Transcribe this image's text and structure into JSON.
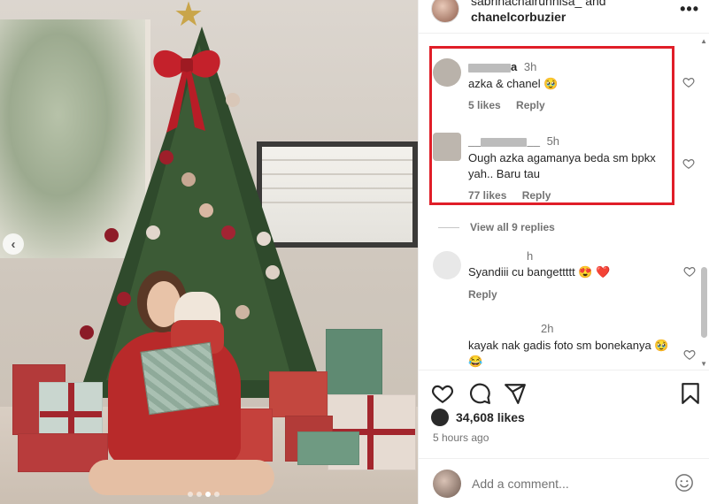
{
  "header": {
    "user1": "sabrinachairunnisa_ and",
    "user2": "chanelcorbuzier",
    "more_label": "•••"
  },
  "comments": [
    {
      "username_suffix": "a",
      "time": "3h",
      "text": "azka & chanel 🥹",
      "likes": "5 likes",
      "reply": "Reply"
    },
    {
      "username_prefix": "__",
      "username_suffix": "__",
      "time": "5h",
      "text": "Ough azka agamanya beda sm bpkx yah.. Baru tau",
      "likes": "77 likes",
      "reply": "Reply"
    },
    {
      "time": "h",
      "text": "Syandiii cu bangettttt 😍 ❤️",
      "reply": "Reply"
    },
    {
      "time": "2h",
      "text": "kayak nak gadis foto sm bonekanya 🥹 😂"
    }
  ],
  "view_replies": "View all 9 replies",
  "likes": "34,608 likes",
  "posted_time": "5 hours ago",
  "add_comment": {
    "placeholder": "Add a comment..."
  },
  "carousel": {
    "total": 4,
    "active": 3
  },
  "colors": {
    "highlight": "#e01e28",
    "like_heart": "#ed4956"
  },
  "icons": [
    "more-options-icon",
    "heart-icon",
    "comment-icon",
    "share-icon",
    "bookmark-icon",
    "emoji-icon",
    "chevron-left-icon"
  ]
}
